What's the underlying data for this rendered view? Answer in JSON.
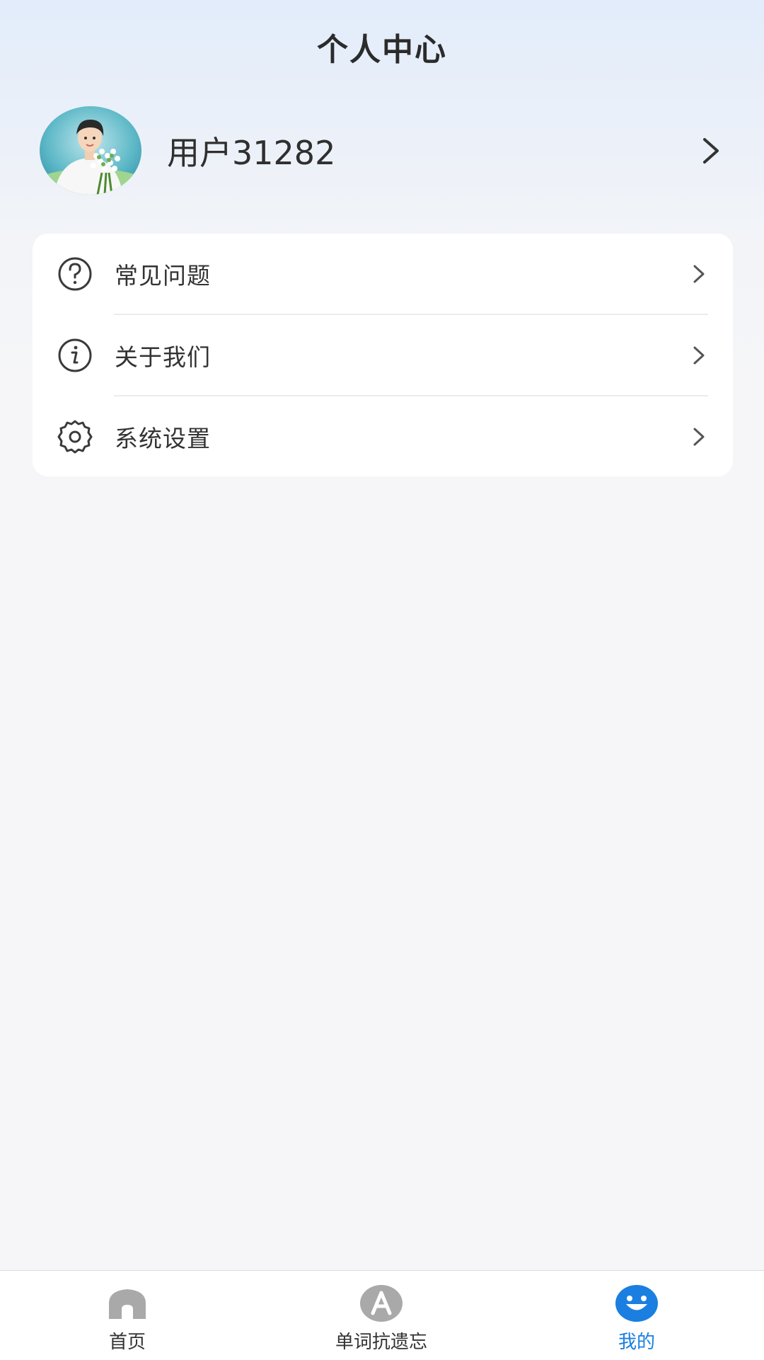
{
  "header": {
    "title": "个人中心"
  },
  "profile": {
    "username": "用户31282",
    "avatar": "avatar-illustration"
  },
  "menu": [
    {
      "label": "常见问题",
      "icon": "question-circle-icon"
    },
    {
      "label": "关于我们",
      "icon": "info-circle-icon"
    },
    {
      "label": "系统设置",
      "icon": "gear-icon"
    }
  ],
  "tabs": [
    {
      "label": "首页",
      "icon": "home-icon",
      "active": false
    },
    {
      "label": "单词抗遗忘",
      "icon": "letter-a-icon",
      "active": false
    },
    {
      "label": "我的",
      "icon": "smile-face-icon",
      "active": true
    }
  ],
  "colors": {
    "accent": "#1a7fe0",
    "inactive_icon": "#a9a9a9",
    "text": "#333333",
    "background": "#f6f6f8"
  }
}
